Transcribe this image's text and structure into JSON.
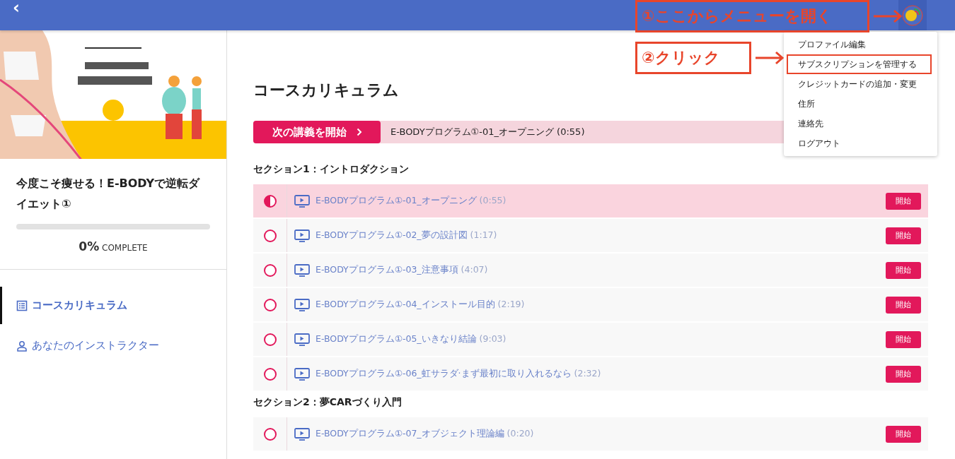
{
  "top_bar": {
    "back": "‹"
  },
  "sidebar": {
    "course_title": "今度こそ痩せる！E-BODYで逆転ダイエット①",
    "progress": {
      "level": 0,
      "percent": "0%",
      "label": "COMPLETE"
    },
    "nav": [
      {
        "label": "コースカリキュラム",
        "selected": true,
        "kind": "list"
      },
      {
        "label": "あなたのインストラクター",
        "selected": false,
        "kind": "person"
      }
    ]
  },
  "main": {
    "title": "コースカリキュラム",
    "next_button": "次の講義を開始",
    "next_lecture": "E-BODYプログラム①-01_オープニング (0:55)",
    "sections": [
      {
        "title": "セクション1：イントロダクション",
        "lectures": [
          {
            "name": "E-BODYプログラム①-01_オープニング",
            "duration": "(0:55)",
            "started": true,
            "selected": true,
            "button": "開始"
          },
          {
            "name": "E-BODYプログラム①-02_夢の設計図",
            "duration": "(1:17)",
            "started": false,
            "selected": false,
            "button": "開始"
          },
          {
            "name": "E-BODYプログラム①-03_注意事項",
            "duration": "(4:07)",
            "started": false,
            "selected": false,
            "button": "開始"
          },
          {
            "name": "E-BODYプログラム①-04_インストール目的",
            "duration": "(2:19)",
            "started": false,
            "selected": false,
            "button": "開始"
          },
          {
            "name": "E-BODYプログラム①-05_いきなり結論",
            "duration": "(9:03)",
            "started": false,
            "selected": false,
            "button": "開始"
          },
          {
            "name": "E-BODYプログラム①-06_虹サラダ·まず最初に取り入れるなら",
            "duration": "(2:32)",
            "started": false,
            "selected": false,
            "button": "開始"
          }
        ]
      },
      {
        "title": "セクション2：夢CARづくり入門",
        "lectures": [
          {
            "name": "E-BODYプログラム①-07_オブジェクト理論編",
            "duration": "(0:20)",
            "started": false,
            "selected": false,
            "button": "開始"
          }
        ]
      }
    ]
  },
  "user_menu": {
    "items": [
      {
        "label": "プロファイル編集",
        "marked": false
      },
      {
        "label": "サブスクリプションを管理する",
        "marked": true
      },
      {
        "label": "クレジットカードの追加・変更",
        "marked": false
      },
      {
        "label": "住所",
        "marked": false
      },
      {
        "label": "連絡先",
        "marked": false
      },
      {
        "label": "ログアウト",
        "marked": false
      }
    ]
  },
  "annotations": [
    {
      "text": "①ここからメニューを開く",
      "kind": "open"
    },
    {
      "text": "②クリック",
      "kind": "click"
    }
  ]
}
